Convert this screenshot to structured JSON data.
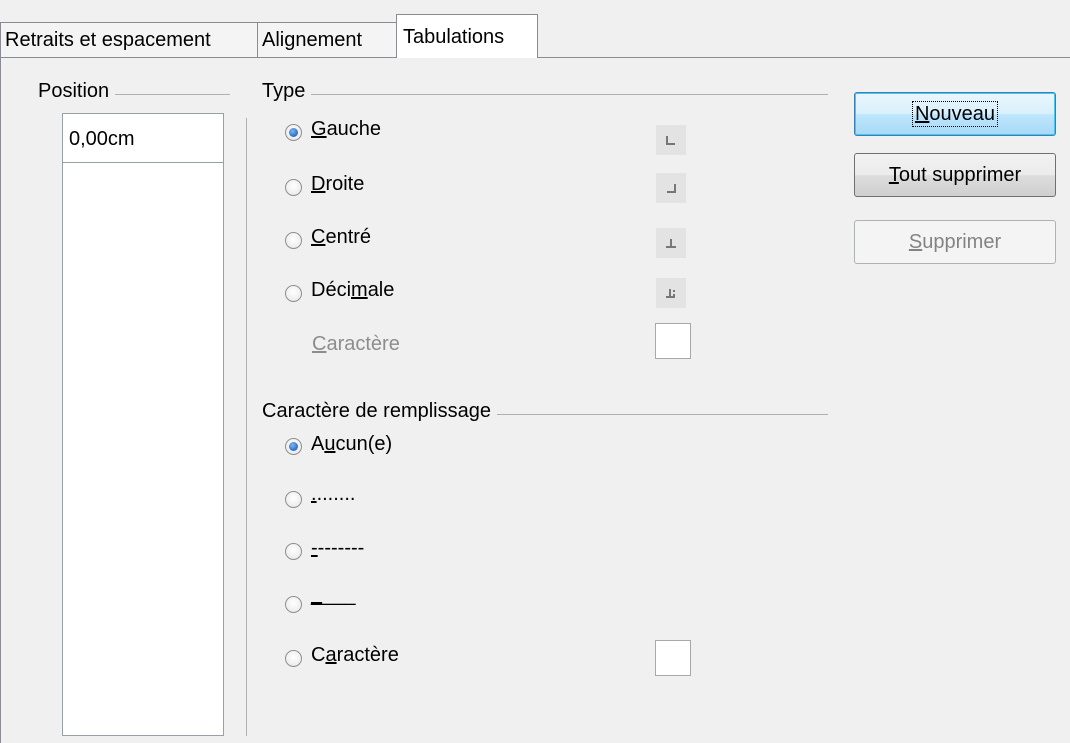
{
  "tabs": [
    {
      "label": "Retraits et espacement",
      "active": false
    },
    {
      "label": "Alignement",
      "active": false
    },
    {
      "label": "Tabulations",
      "active": true
    }
  ],
  "position": {
    "title": "Position",
    "value": "0,00cm",
    "list_items": []
  },
  "type": {
    "title": "Type",
    "options": [
      {
        "pre": "",
        "key": "G",
        "post": "auche",
        "selected": true,
        "icon": "left-tab-icon"
      },
      {
        "pre": "",
        "key": "D",
        "post": "roite",
        "selected": false,
        "icon": "right-tab-icon"
      },
      {
        "pre": "",
        "key": "C",
        "post": "entré",
        "selected": false,
        "icon": "center-tab-icon"
      },
      {
        "pre": "Déci",
        "key": "m",
        "post": "ale",
        "selected": false,
        "icon": "decimal-tab-icon"
      }
    ],
    "character": {
      "pre": "",
      "key": "C",
      "post": "aractère",
      "value": "",
      "disabled": true
    }
  },
  "fill": {
    "title": "Caractère de remplissage",
    "options": [
      {
        "pre": "A",
        "key": "u",
        "post": "cun(e)",
        "selected": true
      },
      {
        "pre": "",
        "key": ".",
        "post": ".......",
        "selected": false
      },
      {
        "pre": "",
        "key": "-",
        "post": "-------",
        "selected": false
      },
      {
        "pre": "",
        "key": "_",
        "post": "___",
        "selected": false
      },
      {
        "pre": "C",
        "key": "a",
        "post": "ractère",
        "selected": false
      }
    ],
    "character_value": ""
  },
  "buttons": {
    "new": {
      "key": "N",
      "post": "ouveau"
    },
    "delete_all": {
      "key": "T",
      "post": "out supprimer"
    },
    "delete": {
      "key": "S",
      "post": "upprimer",
      "disabled": true
    }
  },
  "colors": {
    "accent": "#3c7fb1",
    "radio_dot": "#1f5fbf",
    "disabled_text": "#8d8d8d"
  }
}
